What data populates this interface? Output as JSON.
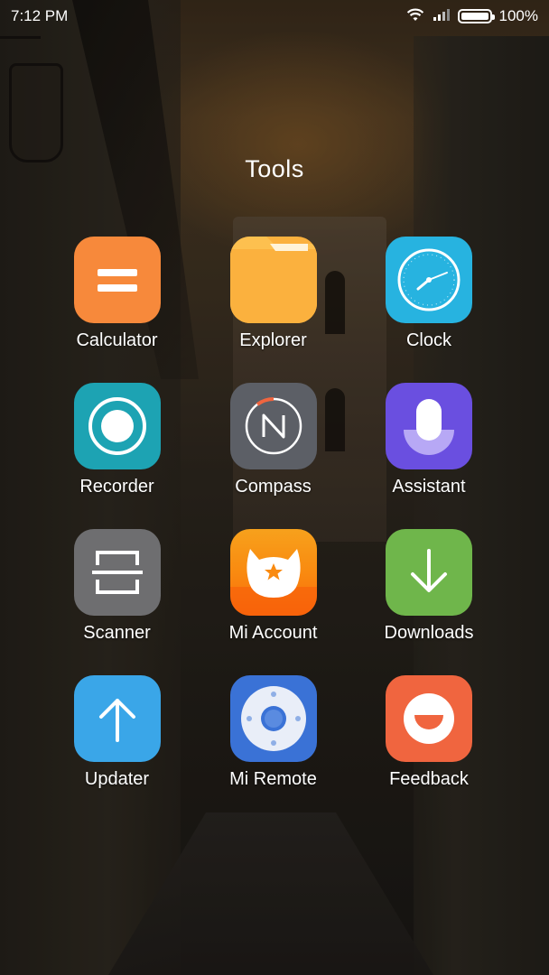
{
  "status_bar": {
    "time": "7:12 PM",
    "battery_percent": "100%",
    "battery_level": 1.0,
    "icons": [
      "wifi-icon",
      "cellular-signal-icon",
      "battery-icon"
    ]
  },
  "folder": {
    "title": "Tools",
    "apps": [
      {
        "label": "Calculator",
        "icon": "calculator-icon",
        "color": "#F7893B"
      },
      {
        "label": "Explorer",
        "icon": "folder-icon",
        "color": "#FBB13E"
      },
      {
        "label": "Clock",
        "icon": "clock-icon",
        "color": "#27B3E0"
      },
      {
        "label": "Recorder",
        "icon": "record-icon",
        "color": "#1DA3B3"
      },
      {
        "label": "Compass",
        "icon": "compass-icon",
        "color": "#5C5F66"
      },
      {
        "label": "Assistant",
        "icon": "assistant-icon",
        "color": "#6A4FE0"
      },
      {
        "label": "Scanner",
        "icon": "scanner-icon",
        "color": "#6E6E70"
      },
      {
        "label": "Mi Account",
        "icon": "mi-bunny-icon",
        "color": "#F98A10"
      },
      {
        "label": "Downloads",
        "icon": "download-icon",
        "color": "#6FB64B"
      },
      {
        "label": "Updater",
        "icon": "arrow-up-icon",
        "color": "#3AA6E8"
      },
      {
        "label": "Mi Remote",
        "icon": "remote-icon",
        "color": "#3A72D6"
      },
      {
        "label": "Feedback",
        "icon": "smiley-icon",
        "color": "#F0653F"
      }
    ]
  }
}
